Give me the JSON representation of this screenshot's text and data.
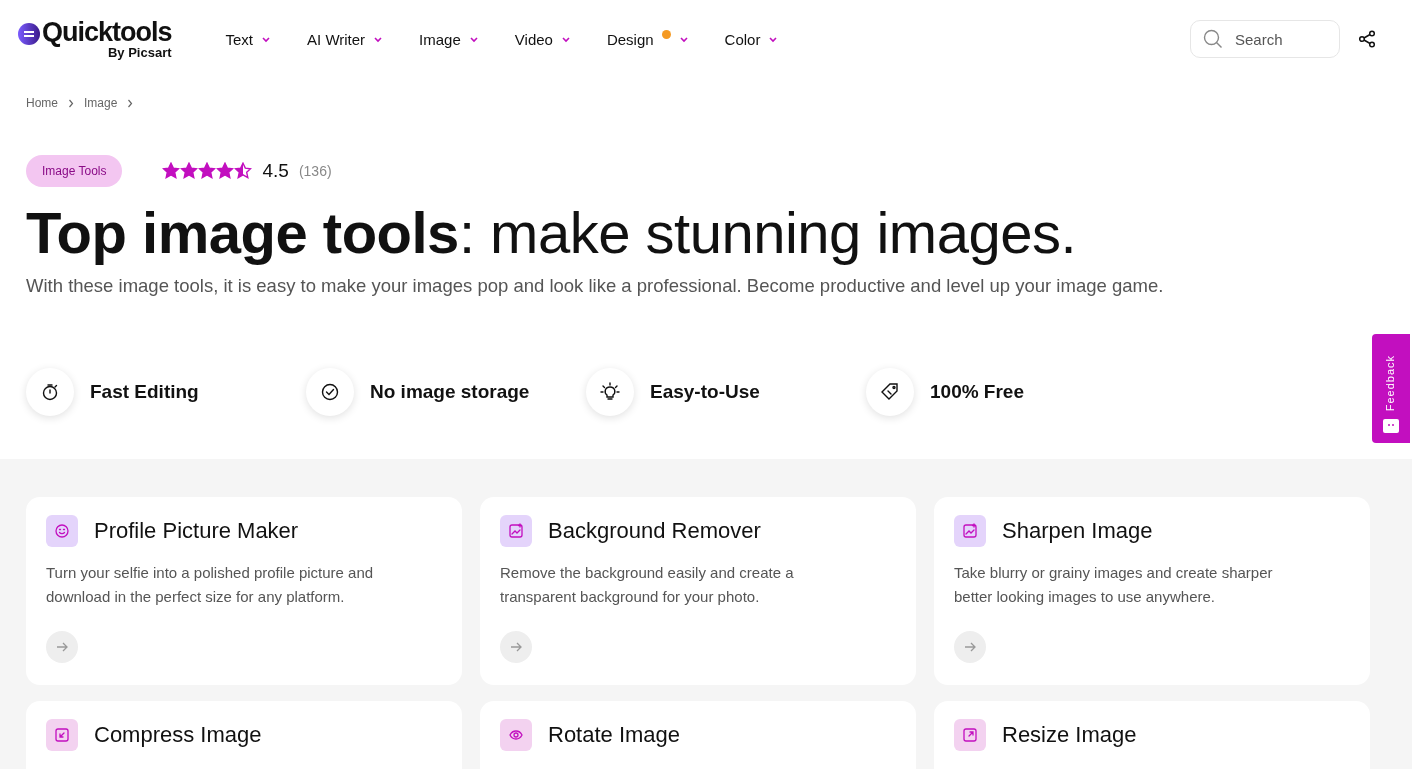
{
  "header": {
    "logo": "Quicktools",
    "logo_sub": "By Picsart",
    "nav": [
      {
        "label": "Text",
        "new": false
      },
      {
        "label": "AI Writer",
        "new": false
      },
      {
        "label": "Image",
        "new": false
      },
      {
        "label": "Video",
        "new": false
      },
      {
        "label": "Design",
        "new": true
      },
      {
        "label": "Color",
        "new": false
      }
    ],
    "search": {
      "placeholder": "Search"
    }
  },
  "breadcrumb": [
    "Home",
    "Image"
  ],
  "hero": {
    "badge": "Image Tools",
    "stars": 4.5,
    "rating": "4.5",
    "count": "(136)",
    "title_bold": "Top image tools",
    "title_rest": ": make stunning images.",
    "subtitle": "With these image tools, it is easy to make your images pop and look like a professional. Become productive and level up your image game."
  },
  "features": [
    {
      "kind": "stopwatch",
      "label": "Fast Editing"
    },
    {
      "kind": "check",
      "label": "No image storage"
    },
    {
      "kind": "bulb",
      "label": "Easy-to-Use"
    },
    {
      "kind": "tag",
      "label": "100% Free"
    }
  ],
  "cards": [
    {
      "kind": "smile",
      "color": "#e4d4fb",
      "title": "Profile Picture Maker",
      "description": "Turn your selfie into a polished profile picture and download in the perfect size for any platform."
    },
    {
      "kind": "photo",
      "color": "#e4d4fb",
      "title": "Background Remover",
      "description": "Remove the background easily and create a transparent background for your photo."
    },
    {
      "kind": "photo",
      "color": "#e4d4fb",
      "title": "Sharpen Image",
      "description": "Take blurry or grainy images and create sharper better looking images to use anywhere."
    },
    {
      "kind": "compress",
      "color": "#f3d2f0",
      "title": "Compress Image"
    },
    {
      "kind": "rotate",
      "color": "#f3d2f0",
      "title": "Rotate Image"
    },
    {
      "kind": "resize",
      "color": "#f3d2f0",
      "title": "Resize Image"
    }
  ],
  "feedback": {
    "label": "Feedback"
  }
}
